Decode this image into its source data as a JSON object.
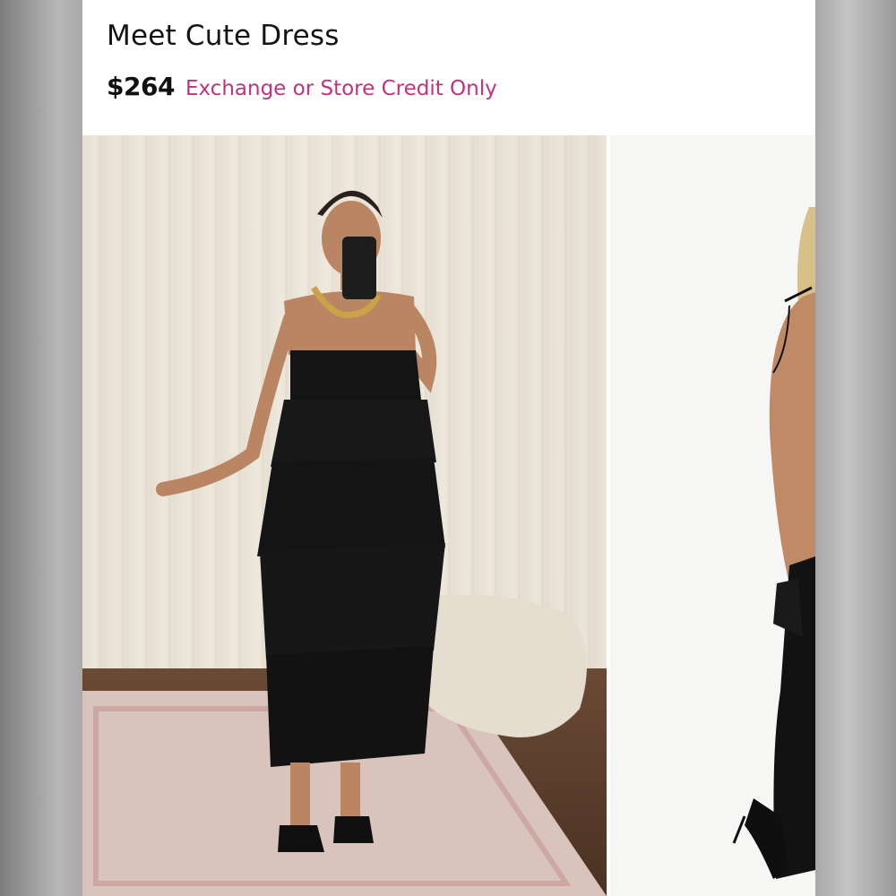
{
  "product": {
    "title": "Meet Cute Dress",
    "price": "$264",
    "return_policy": "Exchange or Store Credit Only"
  },
  "colors": {
    "policy_text": "#c2337a",
    "dress": "#141414",
    "backdrop": "#ffffff"
  },
  "gallery": {
    "images": [
      {
        "name": "model-mirror-selfie-photo"
      },
      {
        "name": "model-studio-photo"
      }
    ]
  }
}
